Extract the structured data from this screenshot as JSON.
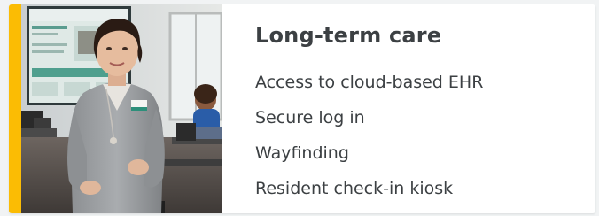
{
  "card": {
    "accent_color": "#fbbc04",
    "title": "Long-term care",
    "features": [
      "Access to cloud-based EHR",
      "Secure log in",
      "Wayfinding",
      "Resident check-in kiosk"
    ]
  },
  "photo": {
    "subject": "care-worker-presenting-photo"
  }
}
